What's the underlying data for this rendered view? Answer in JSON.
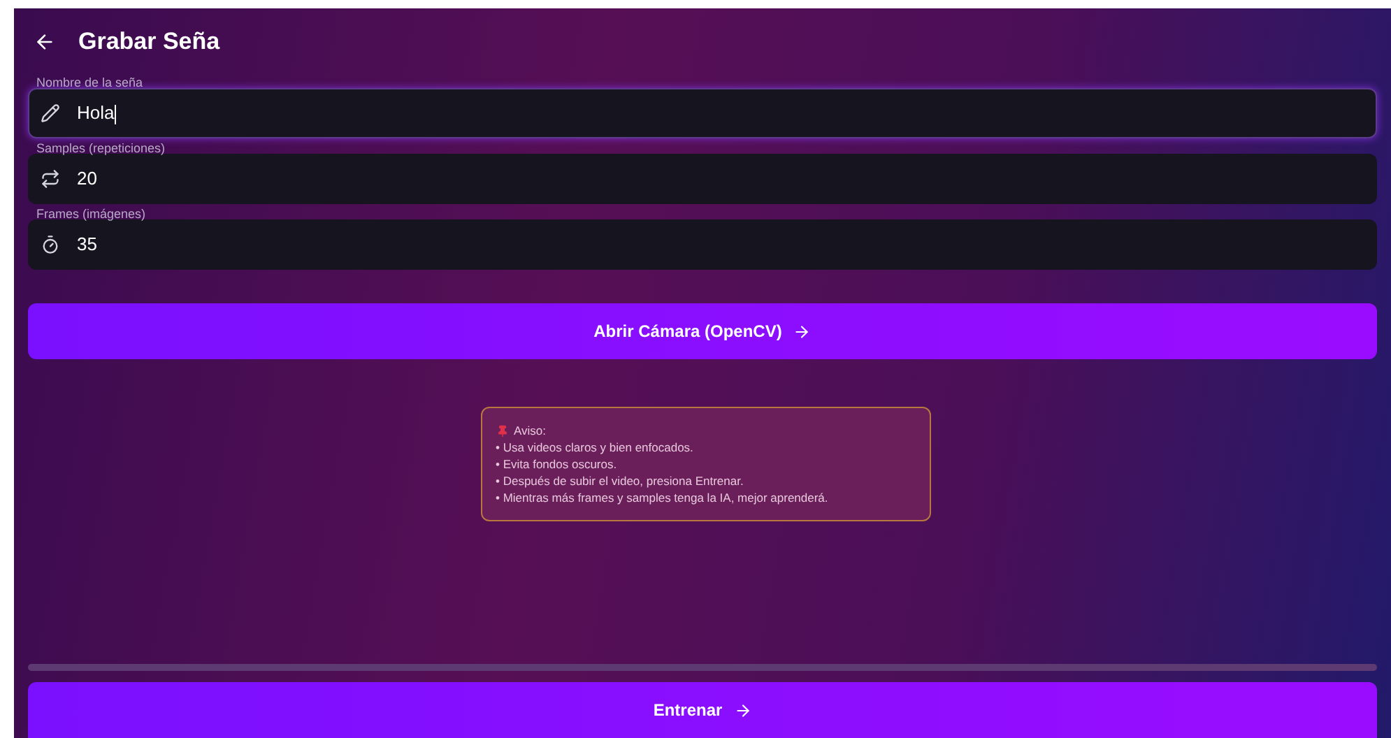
{
  "header": {
    "title": "Grabar Seña"
  },
  "fields": [
    {
      "kind": "pencil",
      "label": "Nombre de la seña",
      "value": "Hola",
      "focused": true
    },
    {
      "kind": "repeat",
      "label": "Samples (repeticiones)",
      "value": "20",
      "focused": false
    },
    {
      "kind": "clock",
      "label": "Frames (imágenes)",
      "value": "35",
      "focused": false
    }
  ],
  "open_camera_button": {
    "label": "Abrir Cámara (OpenCV)"
  },
  "notice": {
    "title": "Aviso:",
    "items": [
      "• Usa videos claros y bien enfocados.",
      "• Evita fondos oscuros.",
      "• Después de subir el video, presiona Entrenar.",
      "• Mientras más frames y samples tenga la IA, mejor aprenderá."
    ]
  },
  "progress": {
    "level": 0
  },
  "train_button": {
    "label": "Entrenar"
  }
}
